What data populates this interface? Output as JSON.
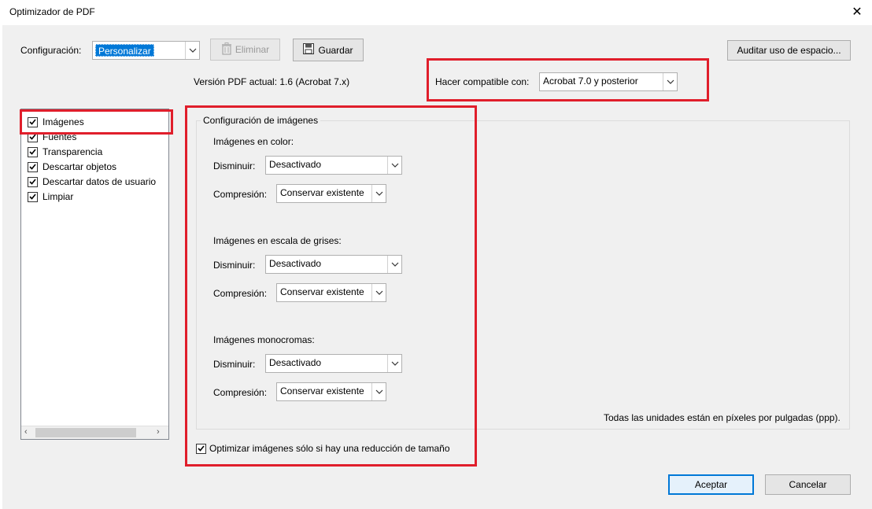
{
  "window": {
    "title": "Optimizador de PDF",
    "close_symbol": "✕"
  },
  "config": {
    "label": "Configuración:",
    "value": "Personalizar",
    "delete_label": "Eliminar",
    "save_label": "Guardar",
    "audit_label": "Auditar uso de espacio..."
  },
  "version": {
    "current": "Versión PDF actual: 1.6 (Acrobat 7.x)",
    "compat_label": "Hacer compatible con:",
    "compat_value": "Acrobat 7.0 y posterior"
  },
  "panels": [
    {
      "label": "Imágenes",
      "checked": true
    },
    {
      "label": "Fuentes",
      "checked": true
    },
    {
      "label": "Transparencia",
      "checked": true
    },
    {
      "label": "Descartar objetos",
      "checked": true
    },
    {
      "label": "Descartar datos de usuario",
      "checked": true
    },
    {
      "label": "Limpiar",
      "checked": true
    }
  ],
  "images": {
    "group_title": "Configuración de imágenes",
    "color": {
      "heading": "Imágenes en color:",
      "downsample_label": "Disminuir:",
      "downsample_value": "Desactivado",
      "compression_label": "Compresión:",
      "compression_value": "Conservar existente"
    },
    "gray": {
      "heading": "Imágenes en escala de grises:",
      "downsample_label": "Disminuir:",
      "downsample_value": "Desactivado",
      "compression_label": "Compresión:",
      "compression_value": "Conservar existente"
    },
    "mono": {
      "heading": "Imágenes monocromas:",
      "downsample_label": "Disminuir:",
      "downsample_value": "Desactivado",
      "compression_label": "Compresión:",
      "compression_value": "Conservar existente"
    },
    "units_note": "Todas las unidades están en píxeles por pulgadas (ppp).",
    "optimize_only_if_smaller": {
      "label": "Optimizar imágenes sólo si hay una reducción de tamaño",
      "checked": true
    }
  },
  "footer": {
    "ok_label": "Aceptar",
    "cancel_label": "Cancelar"
  },
  "colors": {
    "highlight_red": "#e01e2b",
    "focus_blue": "#0078d7",
    "selection_blue": "#0078d7"
  }
}
